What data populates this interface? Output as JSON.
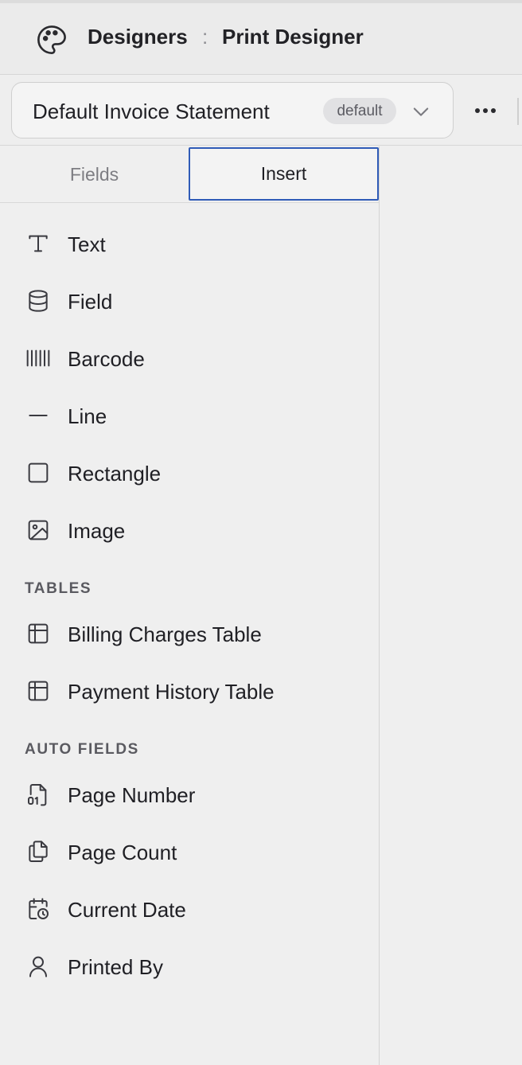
{
  "header": {
    "crumb_parent": "Designers",
    "crumb_separator": ":",
    "crumb_current": "Print Designer",
    "icon": "palette-icon"
  },
  "toolbar": {
    "template_name": "Default Invoice Statement",
    "template_badge": "default",
    "more_icon": "more-horizontal-icon"
  },
  "tabs": [
    {
      "label": "Fields",
      "active": false
    },
    {
      "label": "Insert",
      "active": true
    }
  ],
  "elements": [
    {
      "label": "Text",
      "icon": "text-icon"
    },
    {
      "label": "Field",
      "icon": "database-icon"
    },
    {
      "label": "Barcode",
      "icon": "barcode-icon"
    },
    {
      "label": "Line",
      "icon": "line-icon"
    },
    {
      "label": "Rectangle",
      "icon": "square-icon"
    },
    {
      "label": "Image",
      "icon": "image-icon"
    }
  ],
  "tables": {
    "title": "TABLES",
    "items": [
      {
        "label": "Billing Charges Table",
        "icon": "table-icon"
      },
      {
        "label": "Payment History Table",
        "icon": "table-icon"
      }
    ]
  },
  "auto_fields": {
    "title": "AUTO FIELDS",
    "items": [
      {
        "label": "Page Number",
        "icon": "file-digit-icon"
      },
      {
        "label": "Page Count",
        "icon": "files-icon"
      },
      {
        "label": "Current Date",
        "icon": "calendar-clock-icon"
      },
      {
        "label": "Printed By",
        "icon": "user-icon"
      }
    ]
  },
  "colors": {
    "accent": "#2f5bb7",
    "background": "#efefef",
    "text": "#1f1f24"
  }
}
